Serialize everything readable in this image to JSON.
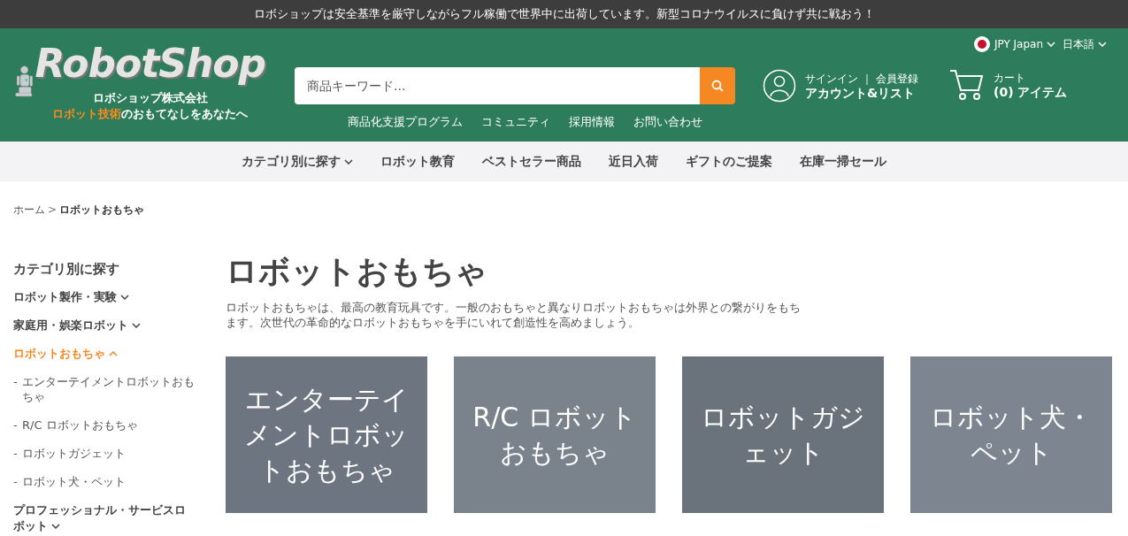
{
  "announcement": "ロボショップは安全基準を厳守しながらフル稼働で世界中に出荷しています。新型コロナウイルスに負けず共に戦おう！",
  "logo": {
    "wordmark": "RobotShop",
    "company": "ロボショップ株式会社",
    "tagline_highlight": "ロボット技術",
    "tagline_rest": "のおもてなしをあなたへ"
  },
  "search": {
    "placeholder": "商品キーワード..."
  },
  "header_links": [
    "商品化支援プログラム",
    "コミュニティ",
    "採用情報",
    "お問い合わせ"
  ],
  "currency": "JPY Japan",
  "language": "日本語",
  "account": {
    "line1": "サインイン ｜ 会員登録",
    "line2": "アカウント&リスト"
  },
  "cart": {
    "line1": "カート",
    "line2": "(0) アイテム"
  },
  "nav": [
    {
      "label": "カテゴリ別に探す",
      "dropdown": true
    },
    {
      "label": "ロボット教育",
      "dropdown": false
    },
    {
      "label": "ベストセラー商品",
      "dropdown": false
    },
    {
      "label": "近日入荷",
      "dropdown": false
    },
    {
      "label": "ギフトのご提案",
      "dropdown": false
    },
    {
      "label": "在庫一掃セール",
      "dropdown": false
    }
  ],
  "breadcrumb": {
    "home": "ホーム",
    "separator": ">",
    "current": "ロボットおもちゃ"
  },
  "sidebar": {
    "title": "カテゴリ別に探す",
    "items": [
      {
        "label": "ロボット製作・実験",
        "expanded": false,
        "selected": false
      },
      {
        "label": "家庭用・娯楽ロボット",
        "expanded": false,
        "selected": false
      },
      {
        "label": "ロボットおもちゃ",
        "expanded": true,
        "selected": true,
        "children": [
          {
            "bullet": "-",
            "label": "エンターテイメントロボットおもちゃ"
          },
          {
            "bullet": "-",
            "label": "R/C ロボットおもちゃ"
          },
          {
            "bullet": "-",
            "label": "ロボットガジェット"
          },
          {
            "bullet": "-",
            "label": "ロボット犬・ペット"
          }
        ]
      },
      {
        "label": "プロフェッショナル・サービスロボット",
        "expanded": false,
        "selected": false
      }
    ]
  },
  "page": {
    "title": "ロボットおもちゃ",
    "description": "ロボットおもちゃは、最高の教育玩具です。一般のおもちゃと異なりロボットおもちゃは外界との繋がりをもちます。次世代の革命的なロボットおもちゃを手にいれて創造性を高めましょう。"
  },
  "cards": [
    {
      "label": "エンターテイメントロボットおもちゃ"
    },
    {
      "label": "R/C ロボットおもちゃ"
    },
    {
      "label": "ロボットガジェット"
    },
    {
      "label": "ロボット犬・ペット"
    }
  ]
}
